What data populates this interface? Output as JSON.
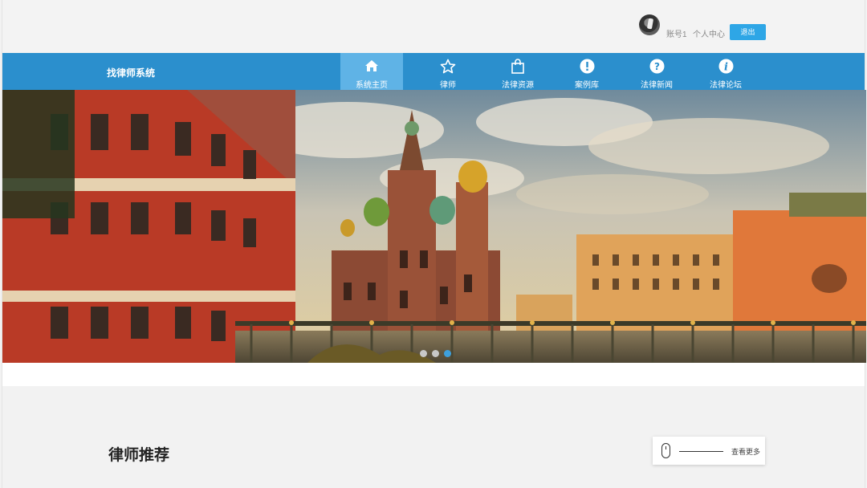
{
  "account": {
    "username": "账号1",
    "center_label": "个人中心",
    "logout_label": "退出"
  },
  "brand": "找律师系统",
  "nav": [
    {
      "label": "系统主页",
      "icon": "home-icon",
      "active": true
    },
    {
      "label": "律师",
      "icon": "star-icon",
      "active": false
    },
    {
      "label": "法律资源",
      "icon": "shopping-bag-icon",
      "active": false
    },
    {
      "label": "案例库",
      "icon": "exclamation-circle-icon",
      "active": false
    },
    {
      "label": "法律新闻",
      "icon": "question-circle-icon",
      "active": false
    },
    {
      "label": "法律论坛",
      "icon": "info-circle-icon",
      "active": false
    }
  ],
  "banner": {
    "slide_count": 3,
    "active_slide": 3
  },
  "section": {
    "title": "律师推荐",
    "more_label": "查看更多"
  },
  "colors": {
    "nav_bg": "#2b8fcd",
    "nav_active": "#5fb3e6",
    "button": "#2ea6e6"
  }
}
